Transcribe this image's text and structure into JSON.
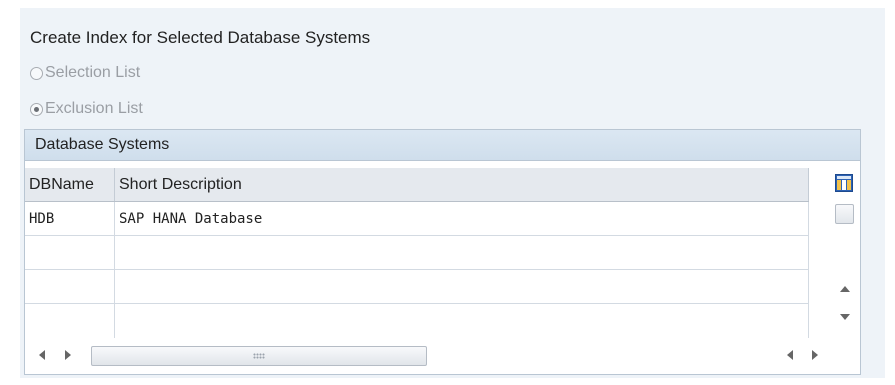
{
  "heading": "Create Index for Selected Database Systems",
  "options": [
    {
      "label": "Selection List",
      "checked": false
    },
    {
      "label": "Exclusion List",
      "checked": true
    }
  ],
  "table": {
    "title": "Database Systems",
    "columns": [
      "DBName",
      "Short Description"
    ],
    "rows": [
      [
        "HDB",
        "SAP HANA Database"
      ],
      [
        "",
        ""
      ],
      [
        "",
        ""
      ],
      [
        "",
        ""
      ]
    ]
  },
  "icons": {
    "layout": "table-layout-icon",
    "select_all": "select-all-checkbox",
    "scroll_up": "scroll-up-icon",
    "scroll_down": "scroll-down-icon",
    "scroll_left": "scroll-left-icon",
    "scroll_right": "scroll-right-icon"
  },
  "colors": {
    "panel_bg": "#eef3f8",
    "title_bar_bg": "#d5e3ef",
    "header_bg": "#e5e9ee",
    "grid_line": "#d3dae2",
    "disabled_text": "#9a9ea4",
    "layout_icon_blue": "#2d62b3",
    "layout_icon_gold": "#e6a817"
  }
}
